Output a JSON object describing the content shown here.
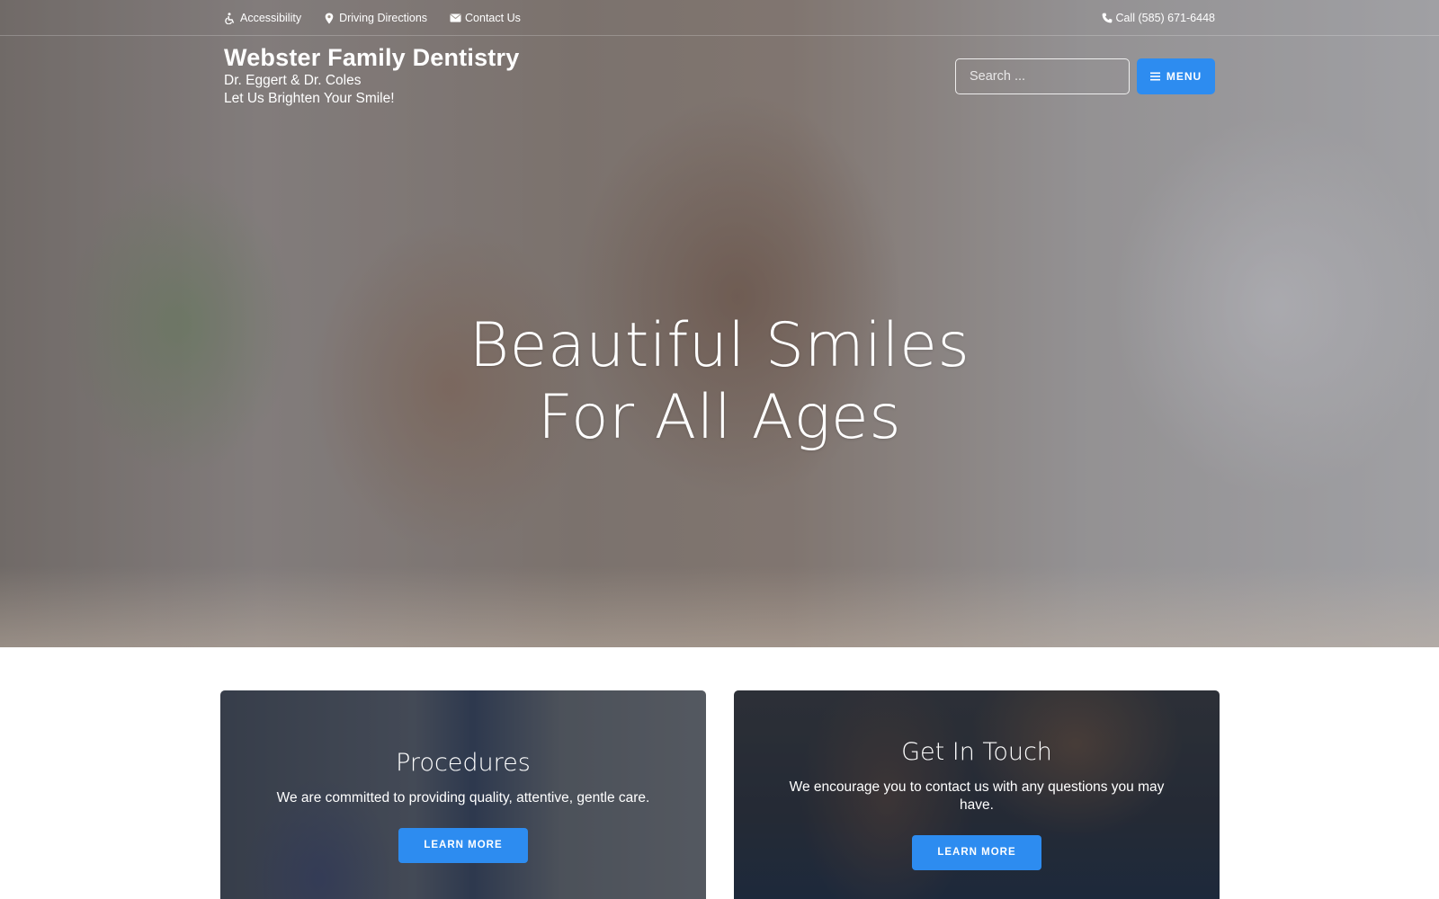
{
  "topbar": {
    "links": [
      {
        "label": "Accessibility",
        "icon": "wheelchair-icon"
      },
      {
        "label": "Driving Directions",
        "icon": "map-marker-icon"
      },
      {
        "label": "Contact Us",
        "icon": "envelope-icon"
      }
    ],
    "phone": {
      "label": "Call (585) 671-6448",
      "icon": "phone-icon"
    }
  },
  "brand": {
    "title": "Webster Family Dentistry",
    "doctors": "Dr. Eggert & Dr. Coles",
    "tagline": "Let Us Brighten Your Smile!"
  },
  "search": {
    "placeholder": "Search ...",
    "value": "",
    "icon": "search-icon"
  },
  "menu": {
    "label": "MENU",
    "icon": "hamburger-icon"
  },
  "hero": {
    "line1": "Beautiful Smiles",
    "line2": "For All Ages"
  },
  "cards": [
    {
      "title": "Procedures",
      "text": "We are committed to providing quality, attentive, gentle care.",
      "button": "LEARN MORE"
    },
    {
      "title": "Get In Touch",
      "text": "We encourage you to contact us with any questions you may have.",
      "button": "LEARN MORE"
    }
  ],
  "colors": {
    "accent": "#2d8cf0",
    "text_on_hero": "#ffffff"
  }
}
